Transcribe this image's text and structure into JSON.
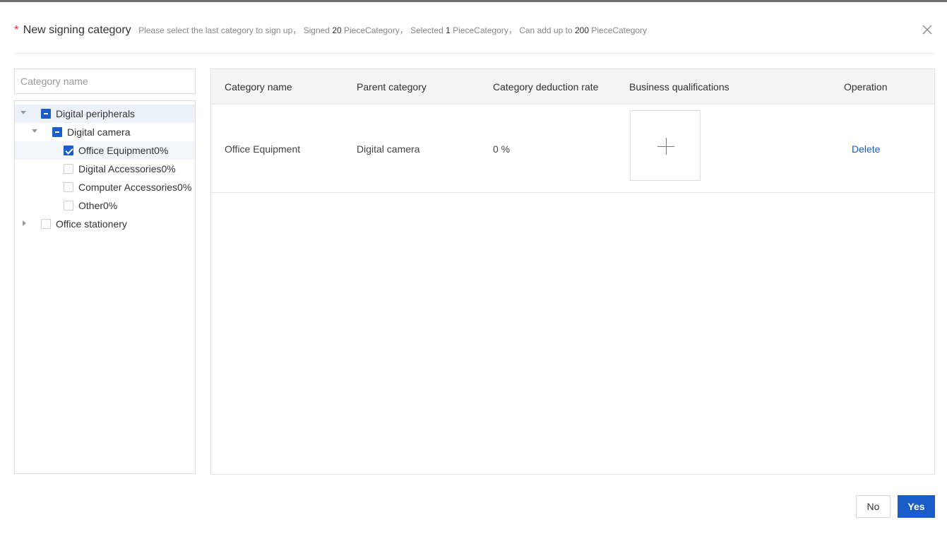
{
  "dialog": {
    "required_mark": "*",
    "title": "New signing category",
    "desc": {
      "intro": "Please select the last category to sign up，",
      "signed_prefix": "Signed",
      "signed_count": "20",
      "signed_suffix": "PieceCategory，",
      "selected_prefix": "Selected",
      "selected_count": "1",
      "selected_suffix": "PieceCategory，",
      "limit_prefix": "Can add up to",
      "limit_count": "200",
      "limit_suffix": "PieceCategory"
    }
  },
  "search": {
    "placeholder": "Category name",
    "value": ""
  },
  "tree": [
    {
      "label": "Digital peripherals",
      "level": 0,
      "expanded": true,
      "check": "indeterminate"
    },
    {
      "label": "Digital camera",
      "level": 1,
      "expanded": true,
      "check": "indeterminate"
    },
    {
      "label": "Office Equipment0%",
      "level": 2,
      "check": "checked"
    },
    {
      "label": "Digital Accessories0%",
      "level": 2,
      "check": "unchecked"
    },
    {
      "label": "Computer Accessories0%",
      "level": 2,
      "check": "unchecked"
    },
    {
      "label": "Other0%",
      "level": 2,
      "check": "unchecked"
    },
    {
      "label": "Office stationery",
      "level": 0,
      "expanded": false,
      "check": "unchecked"
    }
  ],
  "table": {
    "columns": [
      "Category name",
      "Parent category",
      "Category deduction rate",
      "Business qualifications",
      "Operation"
    ],
    "rows": [
      {
        "category": "Office Equipment",
        "parent": "Digital camera",
        "rate": "0 %",
        "operation": "Delete"
      }
    ]
  },
  "footer": {
    "no_label": "No",
    "yes_label": "Yes"
  },
  "colors": {
    "primary": "#1a5dc9",
    "required": "#f5222d",
    "header_bg": "#f4f4f4"
  },
  "icons": {
    "close": "close-icon",
    "upload": "plus-icon",
    "tree_toggle": "caret-icon"
  }
}
